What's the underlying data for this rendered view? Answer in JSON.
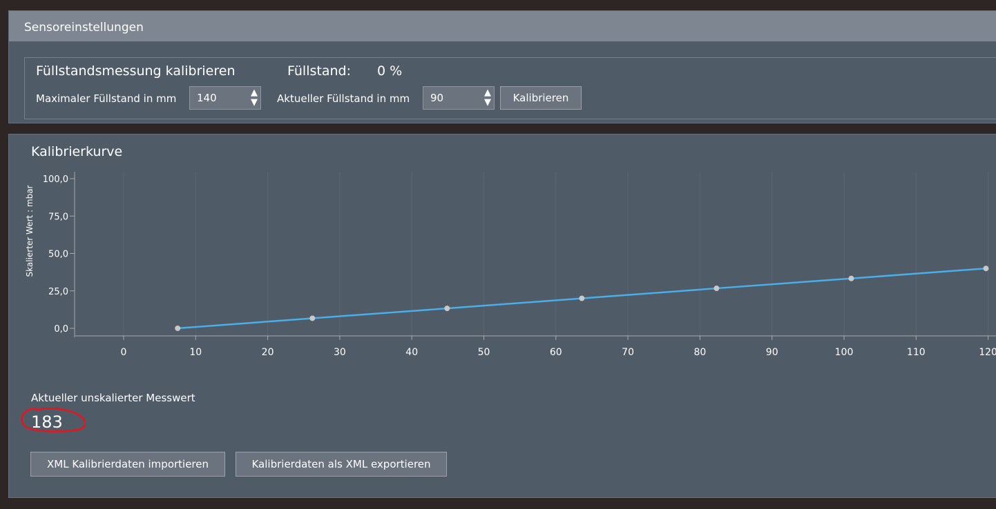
{
  "header": {
    "title": "Sensoreinstellungen"
  },
  "calibrate": {
    "title": "Füllstandsmessung kalibrieren",
    "level_label": "Füllstand:",
    "level_value": "0 %",
    "max_label": "Maximaler Füllstand in mm",
    "max_value": "140",
    "current_label": "Aktueller Füllstand in mm",
    "current_value": "90",
    "calibrate_button": "Kalibrieren"
  },
  "curve": {
    "title": "Kalibrierkurve",
    "measure_label": "Aktueller unskalierter Messwert",
    "measure_value": "183",
    "import_button": "XML Kalibrierdaten importieren",
    "export_button": "Kalibrierdaten als XML exportieren"
  },
  "colors": {
    "line": "#4aaee8",
    "point": "#c8c8c8",
    "annotation": "#e8141c"
  },
  "chart_data": {
    "type": "line",
    "ylabel": "Skalierter Wert : mbar",
    "xlabel": "",
    "xlim": [
      -6.8,
      126
    ],
    "ylim": [
      -5,
      105
    ],
    "xticks": [
      0,
      10,
      20,
      30,
      40,
      50,
      60,
      70,
      80,
      90,
      100,
      110,
      120
    ],
    "yticks": [
      {
        "v": 0,
        "label": "0,0"
      },
      {
        "v": 25,
        "label": "25,0"
      },
      {
        "v": 50,
        "label": "50,0"
      },
      {
        "v": 75,
        "label": "75,0"
      },
      {
        "v": 100,
        "label": "100,0"
      }
    ],
    "x": [
      7.5,
      26.2,
      44.9,
      63.6,
      82.3,
      101,
      119.7
    ],
    "y": [
      0,
      6.7,
      13.3,
      20,
      26.7,
      33.3,
      40
    ]
  }
}
